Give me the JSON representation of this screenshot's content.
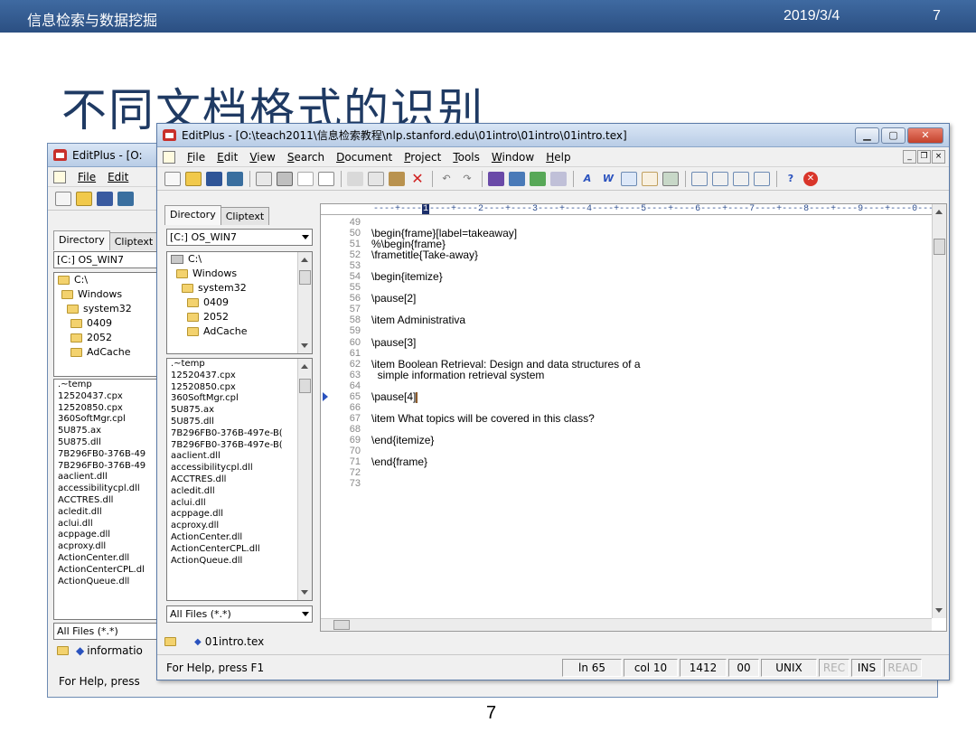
{
  "slide": {
    "course": "信息检索与数据挖掘",
    "date": "2019/3/4",
    "page": "7",
    "title": "不同文档格式的识别",
    "footer_page": "7"
  },
  "back_window": {
    "title": "EditPlus - [O:",
    "menu": [
      "File",
      "Edit"
    ],
    "tabs": [
      "Directory",
      "Cliptext"
    ],
    "drive": "[C:] OS_WIN7",
    "folders": [
      "C:\\",
      "Windows",
      "system32",
      "0409",
      "2052",
      "AdCache"
    ],
    "files": [
      ".~temp",
      "12520437.cpx",
      "12520850.cpx",
      "360SoftMgr.cpl",
      "5U875.ax",
      "5U875.dll",
      "7B296FB0-376B-49",
      "7B296FB0-376B-49",
      "aaclient.dll",
      "accessibilitycpl.dll",
      "ACCTRES.dll",
      "acledit.dll",
      "aclui.dll",
      "acppage.dll",
      "acproxy.dll",
      "ActionCenter.dll",
      "ActionCenterCPL.dl",
      "ActionQueue.dll"
    ],
    "filter": "All Files (*.*)",
    "doc_tab": "informatio",
    "status": "For Help, press"
  },
  "window": {
    "title": "EditPlus - [O:\\teach2011\\信息检索教程\\nlp.stanford.edu\\01intro\\01intro\\01intro.tex]",
    "menu": [
      "File",
      "Edit",
      "View",
      "Search",
      "Document",
      "Project",
      "Tools",
      "Window",
      "Help"
    ],
    "menu_access_keys": [
      "F",
      "E",
      "V",
      "S",
      "D",
      "P",
      "T",
      "W",
      "H"
    ]
  },
  "sidebar": {
    "tabs": [
      "Directory",
      "Cliptext"
    ],
    "drive": "[C:] OS_WIN7",
    "folders": [
      {
        "name": "C:\\",
        "icon": "drive-icon"
      },
      {
        "name": "Windows",
        "icon": "open-folder-icon"
      },
      {
        "name": "system32",
        "icon": "open-folder-icon"
      },
      {
        "name": "0409",
        "icon": "folder-icon"
      },
      {
        "name": "2052",
        "icon": "folder-icon"
      },
      {
        "name": "AdCache",
        "icon": "folder-icon"
      }
    ],
    "files": [
      ".~temp",
      "12520437.cpx",
      "12520850.cpx",
      "360SoftMgr.cpl",
      "5U875.ax",
      "5U875.dll",
      "7B296FB0-376B-497e-B(",
      "7B296FB0-376B-497e-B(",
      "aaclient.dll",
      "accessibilitycpl.dll",
      "ACCTRES.dll",
      "acledit.dll",
      "aclui.dll",
      "acppage.dll",
      "acproxy.dll",
      "ActionCenter.dll",
      "ActionCenterCPL.dll",
      "ActionQueue.dll"
    ],
    "filter": "All Files (*.*)"
  },
  "editor": {
    "ruler": "----+----1----+----2----+----3----+----4----+----5----+----6----+----7----+----8----+----9----+----0----+",
    "ruler_cursor_column": 10,
    "lines": [
      {
        "n": "49",
        "text": ""
      },
      {
        "n": "50",
        "text": "\\begin{frame}[label=takeaway]"
      },
      {
        "n": "51",
        "text": "%\\begin{frame}"
      },
      {
        "n": "52",
        "text": "\\frametitle{Take-away}"
      },
      {
        "n": "53",
        "text": ""
      },
      {
        "n": "54",
        "text": "\\begin{itemize}"
      },
      {
        "n": "55",
        "text": ""
      },
      {
        "n": "56",
        "text": "\\pause[2]"
      },
      {
        "n": "57",
        "text": ""
      },
      {
        "n": "58",
        "text": "\\item Administrativa"
      },
      {
        "n": "59",
        "text": ""
      },
      {
        "n": "60",
        "text": "\\pause[3]"
      },
      {
        "n": "61",
        "text": ""
      },
      {
        "n": "62",
        "text": "\\item Boolean Retrieval: Design and data structures of a"
      },
      {
        "n": "63",
        "text": "  simple information retrieval system"
      },
      {
        "n": "64",
        "text": ""
      },
      {
        "n": "65",
        "text": "\\pause[4]"
      },
      {
        "n": "66",
        "text": ""
      },
      {
        "n": "67",
        "text": "\\item What topics will be covered in this class?"
      },
      {
        "n": "68",
        "text": ""
      },
      {
        "n": "69",
        "text": "\\end{itemize}"
      },
      {
        "n": "70",
        "text": ""
      },
      {
        "n": "71",
        "text": "\\end{frame}"
      },
      {
        "n": "72",
        "text": ""
      },
      {
        "n": "73",
        "text": ""
      }
    ],
    "current_line": "65",
    "doc_tab": "01intro.tex"
  },
  "status": {
    "help": "For Help, press F1",
    "line": "ln 65",
    "col": "col 10",
    "chars": "1412",
    "code": "00",
    "format": "UNIX",
    "rec": "REC",
    "ins": "INS",
    "read": "READ"
  },
  "colors": {
    "header_bar": "#2b4f82",
    "slide_title": "#1f3a63",
    "close_button": "#c4412b"
  }
}
